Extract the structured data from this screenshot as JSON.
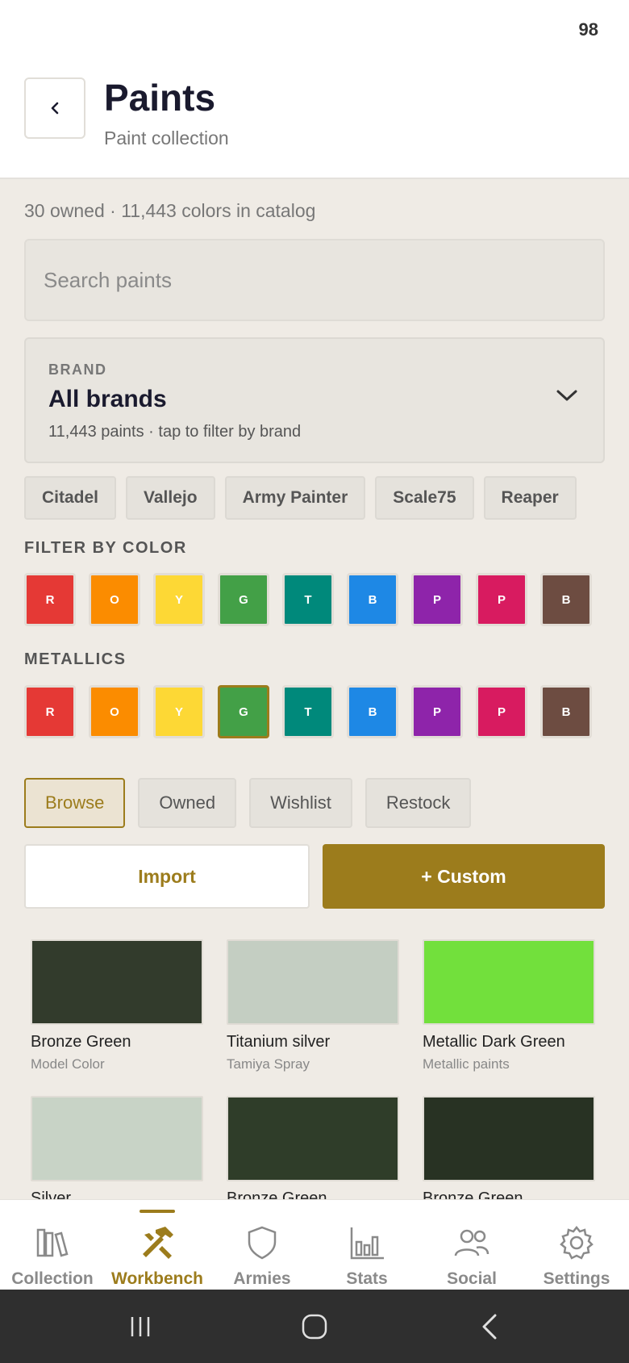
{
  "status": {
    "battery": "98"
  },
  "header": {
    "title": "Paints",
    "subtitle": "Paint collection"
  },
  "summary": "30 owned · 11,443 colors in catalog",
  "search": {
    "placeholder": "Search paints",
    "value": ""
  },
  "brand_filter": {
    "label": "BRAND",
    "value": "All brands",
    "hint": "11,443 paints · tap to filter by brand"
  },
  "brand_chips": [
    "Citadel",
    "Vallejo",
    "Army Painter",
    "Scale75",
    "Reaper"
  ],
  "filter_by_color": {
    "title": "FILTER BY COLOR",
    "swatches": [
      {
        "letter": "R",
        "color": "#e53935"
      },
      {
        "letter": "O",
        "color": "#fb8c00"
      },
      {
        "letter": "Y",
        "color": "#fdd835"
      },
      {
        "letter": "G",
        "color": "#43a047"
      },
      {
        "letter": "T",
        "color": "#00897b"
      },
      {
        "letter": "B",
        "color": "#1e88e5"
      },
      {
        "letter": "P",
        "color": "#8e24aa"
      },
      {
        "letter": "P",
        "color": "#d81b60"
      },
      {
        "letter": "B",
        "color": "#6d4c41"
      }
    ]
  },
  "metallics": {
    "title": "METALLICS",
    "selected_index": 3,
    "swatches": [
      {
        "letter": "R",
        "color": "#e53935"
      },
      {
        "letter": "O",
        "color": "#fb8c00"
      },
      {
        "letter": "Y",
        "color": "#fdd835"
      },
      {
        "letter": "G",
        "color": "#43a047"
      },
      {
        "letter": "T",
        "color": "#00897b"
      },
      {
        "letter": "B",
        "color": "#1e88e5"
      },
      {
        "letter": "P",
        "color": "#8e24aa"
      },
      {
        "letter": "P",
        "color": "#d81b60"
      },
      {
        "letter": "B",
        "color": "#6d4c41"
      }
    ]
  },
  "view_tabs": {
    "active": "Browse",
    "items": [
      "Browse",
      "Owned",
      "Wishlist",
      "Restock"
    ]
  },
  "actions": {
    "import": "Import",
    "custom": "+ Custom"
  },
  "paints": [
    {
      "name": "Bronze Green",
      "brand": "Model Color",
      "color": "#323b2c"
    },
    {
      "name": "Titanium silver",
      "brand": "Tamiya Spray",
      "color": "#c4cec2"
    },
    {
      "name": "Metallic Dark Green",
      "brand": "Metallic paints",
      "color": "#72e03c"
    },
    {
      "name": "Silver",
      "brand": "",
      "color": "#c8d3c6"
    },
    {
      "name": "Bronze Green",
      "brand": "",
      "color": "#2f3d29"
    },
    {
      "name": "Bronze Green",
      "brand": "",
      "color": "#283223"
    }
  ],
  "nav": {
    "active": "Workbench",
    "items": [
      {
        "label": "Collection",
        "icon": "books-icon"
      },
      {
        "label": "Workbench",
        "icon": "tools-icon"
      },
      {
        "label": "Armies",
        "icon": "shield-icon"
      },
      {
        "label": "Stats",
        "icon": "bar-chart-icon"
      },
      {
        "label": "Social",
        "icon": "people-icon"
      },
      {
        "label": "Settings",
        "icon": "gear-icon"
      }
    ]
  },
  "colors": {
    "accent": "#9c7c1c",
    "background": "#efebe5"
  }
}
